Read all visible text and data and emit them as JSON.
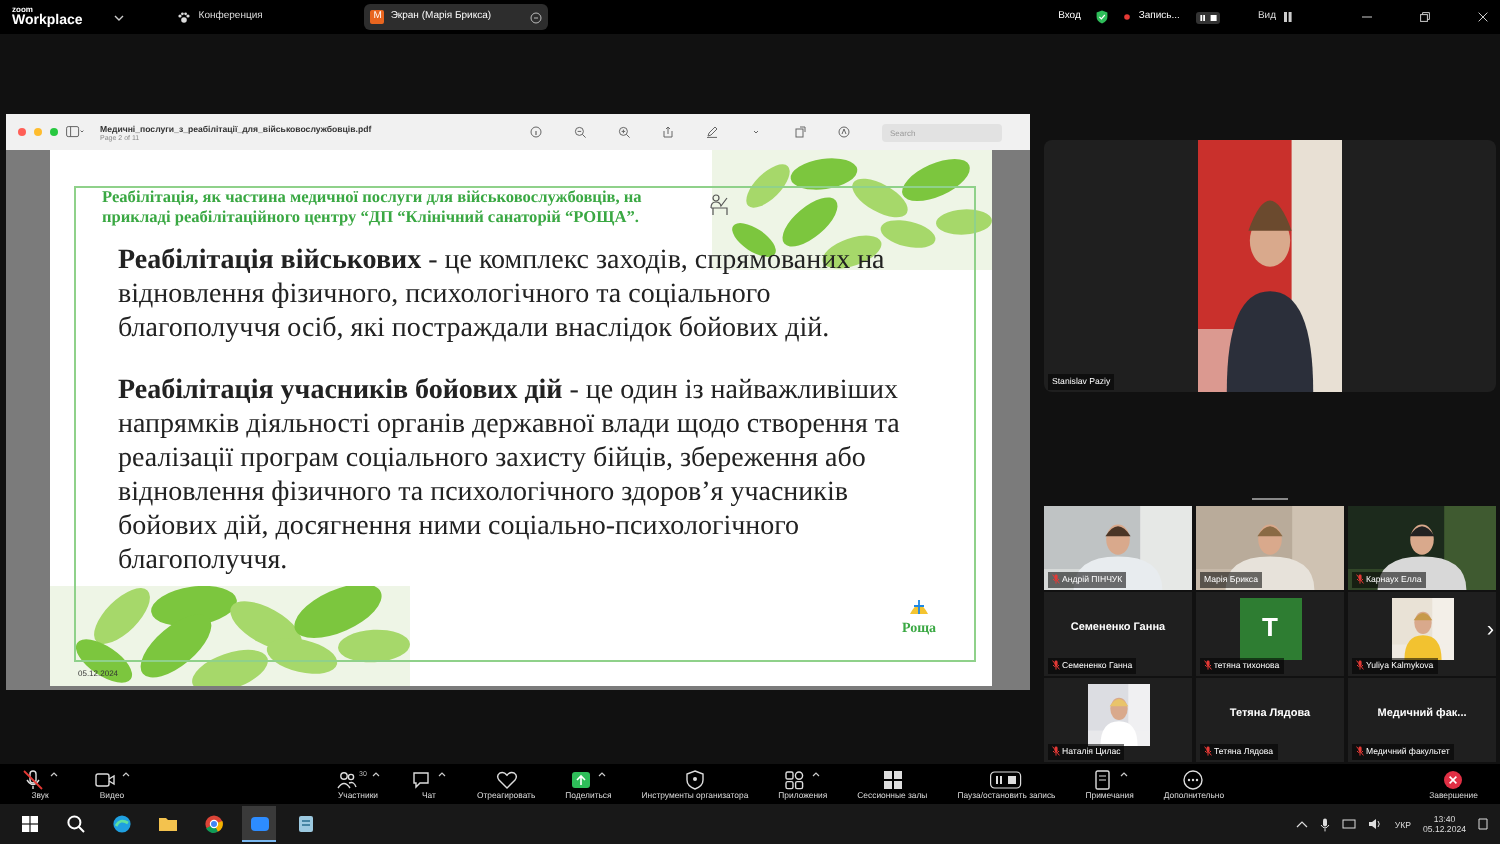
{
  "app": {
    "logo_top": "zoom",
    "logo_bottom": "Workplace",
    "menu": "Конференция"
  },
  "share_tab": {
    "avatar": "М",
    "label": "Экран (Марія Брикса)"
  },
  "top_right": {
    "signin": "Вход",
    "recording": "Запись...",
    "view": "Вид"
  },
  "pdf": {
    "filename": "Медичні_послуги_з_реабілітації_для_військовослужбовців.pdf",
    "page": "Page 2 of 11",
    "search_placeholder": "Search"
  },
  "slide": {
    "title": "Реабілітація, як частина медичної послуги для військовослужбовців, на прикладі реабілітаційного центру “ДП “Клінічний санаторій “РОЩА”.",
    "paragraphs": [
      "**Реабілітація військових** - це комплекс заходів, спрямованих на відновлення фізичного, психологічного та соціального благополуччя осіб, які постраждали внаслідок бойових дій.",
      "**Реабілітація учасників бойових дій** - це один із найважливіших напрямків діяльності органів державної влади щодо створення та реалізації програм соціального захисту бійців, збереження або відновлення фізичного та психологічного здоров’я учасників бойових дій, досягнення ними соціально-психологічного благополуччя."
    ],
    "date": "05.12.2024",
    "logo": "Роща"
  },
  "speaker": {
    "name": "Stanislav Paziy",
    "muted": false
  },
  "gallery": [
    {
      "kind": "video",
      "label": "Андрій ПІНЧУК",
      "muted": true
    },
    {
      "kind": "video",
      "label": "Марія Брикса",
      "muted": false
    },
    {
      "kind": "video",
      "label": "Карнаух Елла",
      "muted": true
    },
    {
      "kind": "name",
      "display": "Семененко Ганна",
      "label": "Семененко Ганна",
      "muted": true
    },
    {
      "kind": "letter",
      "display": "T",
      "color": "#2e7d32",
      "label": "тетяна тихонова",
      "muted": true
    },
    {
      "label": "Yuliya Kalmykova",
      "muted": true
    },
    {
      "label": "Наталія Цилас",
      "muted": true
    },
    {
      "kind": "name",
      "display": "Тетяна Лядова",
      "label": "Тетяна Лядова",
      "muted": true
    },
    {
      "kind": "name",
      "display": "Медичний фак...",
      "label": "Медичний факультет",
      "muted": true
    }
  ],
  "next_page": "›",
  "toolbar": [
    {
      "label": "Звук",
      "has_menu": true,
      "muted": true
    },
    {
      "label": "Видео",
      "has_menu": true
    },
    {
      "label": "Участники",
      "count": "30",
      "has_menu": true
    },
    {
      "label": "Чат",
      "has_menu": true
    },
    {
      "label": "Отреагировать",
      "has_menu": false
    },
    {
      "label": "Поделиться",
      "has_menu": true
    },
    {
      "label": "Инструменты организатора",
      "has_menu": false
    },
    {
      "label": "Приложения",
      "has_menu": true
    },
    {
      "label": "Сессионные залы",
      "has_menu": false
    },
    {
      "label": "Пауза/остановить запись",
      "has_menu": false
    },
    {
      "label": "Примечания",
      "has_menu": true
    },
    {
      "label": "Дополнительно",
      "has_menu": false
    },
    {
      "label": "Завершение",
      "has_menu": false
    }
  ],
  "taskbar": {
    "lang": "УКР",
    "time": "13:40",
    "date": "05.12.2024"
  }
}
